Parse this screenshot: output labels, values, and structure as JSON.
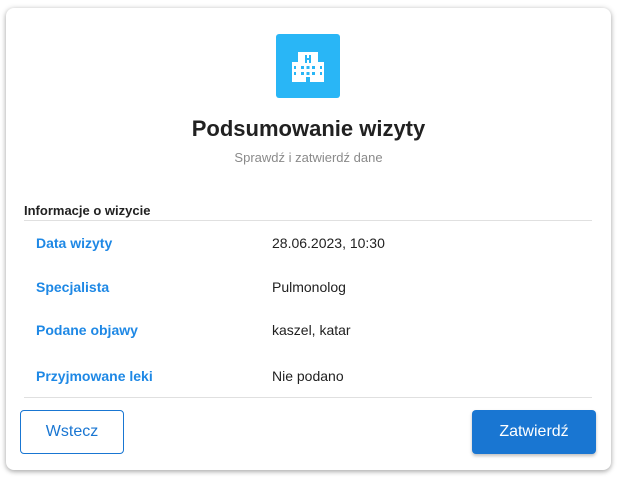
{
  "header": {
    "icon": "hospital-building-icon",
    "title": "Podsumowanie wizyty",
    "subtitle": "Sprawdź i zatwierdź dane"
  },
  "section": {
    "title": "Informacje o wizycie",
    "rows": [
      {
        "label": "Data wizyty",
        "value": "28.06.2023, 10:30"
      },
      {
        "label": "Specjalista",
        "value": "Pulmonolog"
      },
      {
        "label": "Podane objawy",
        "value": "kaszel, katar"
      },
      {
        "label": "Przyjmowane leki",
        "value": "Nie podano"
      }
    ]
  },
  "actions": {
    "back_label": "Wstecz",
    "confirm_label": "Zatwierdź"
  },
  "colors": {
    "accent": "#1976d2",
    "label": "#1e88e5",
    "logo_background": "#29b6f6"
  }
}
